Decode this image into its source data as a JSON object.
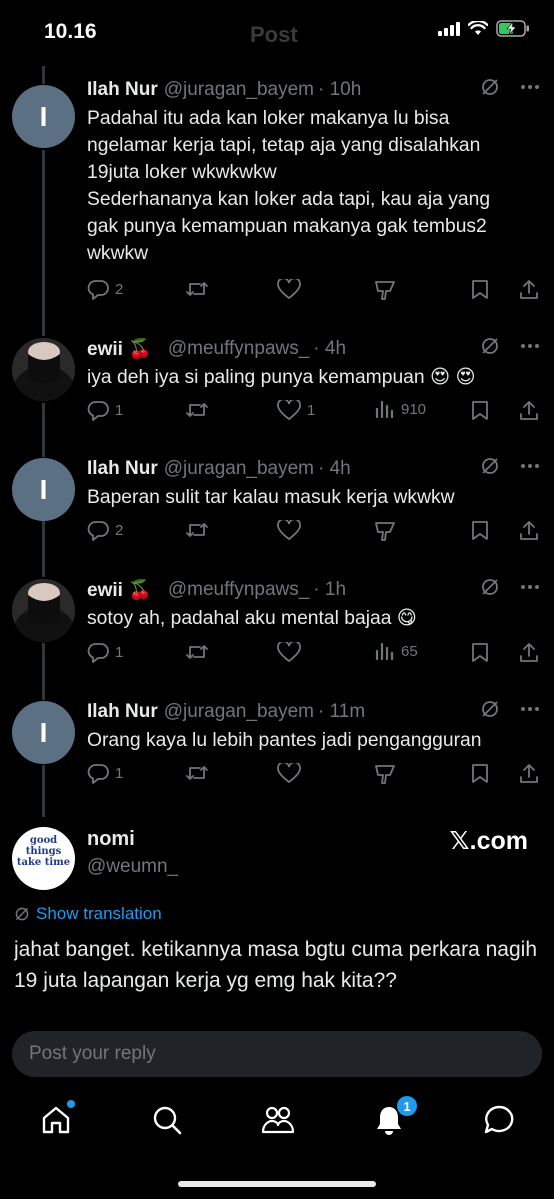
{
  "status": {
    "time": "10.16",
    "title_ghost": "Post"
  },
  "tweets": [
    {
      "name": "Ilah Nur",
      "handle": "@juragan_bayem",
      "time": "· 10h",
      "avatar_letter": "I",
      "lines": [
        "Padahal itu ada kan loker makanya lu bisa",
        "ngelamar kerja tapi, tetap aja yang disalahkan",
        "19juta loker wkwkwkw",
        "Sederhananya kan loker ada tapi, kau aja yang",
        "gak punya kemampuan makanya gak tembus2",
        "wkwkw"
      ],
      "replies": "2",
      "likes": "",
      "views": ""
    },
    {
      "name": "ewii 🍒",
      "handle": "@meuffynpaws_",
      "time": "· 4h",
      "avatar_letter": "",
      "lines": [
        "iya deh iya si paling punya kemampuan 😍 😍"
      ],
      "replies": "1",
      "likes": "1",
      "views": "910"
    },
    {
      "name": "Ilah Nur",
      "handle": "@juragan_bayem",
      "time": "· 4h",
      "avatar_letter": "I",
      "lines": [
        "Baperan sulit tar kalau masuk kerja wkwkw"
      ],
      "replies": "2",
      "likes": "",
      "views": ""
    },
    {
      "name": "ewii 🍒",
      "handle": "@meuffynpaws_",
      "time": "· 1h",
      "avatar_letter": "",
      "lines": [
        "sotoy ah, padahal aku mental bajaa 😋"
      ],
      "replies": "1",
      "likes": "",
      "views": "65"
    },
    {
      "name": "Ilah Nur",
      "handle": "@juragan_bayem",
      "time": "· 11m",
      "avatar_letter": "I",
      "lines": [
        "Orang kaya lu lebih pantes jadi pengangguran"
      ],
      "replies": "1",
      "likes": "",
      "views": ""
    }
  ],
  "main_post": {
    "name": "nomi",
    "handle": "@weumn_",
    "avatar_text": "good things take time",
    "brand": "𝕏.com",
    "show_translation": "Show translation",
    "text": "jahat banget. ketikannya masa bgtu cuma perkara nagih 19 juta lapangan kerja yg emg hak kita??"
  },
  "reply": {
    "placeholder": "Post your reply"
  },
  "nav": {
    "notifications_badge": "1"
  },
  "colors": {
    "background": "#000000",
    "muted": "#71767b",
    "accent": "#1d9bf0"
  }
}
